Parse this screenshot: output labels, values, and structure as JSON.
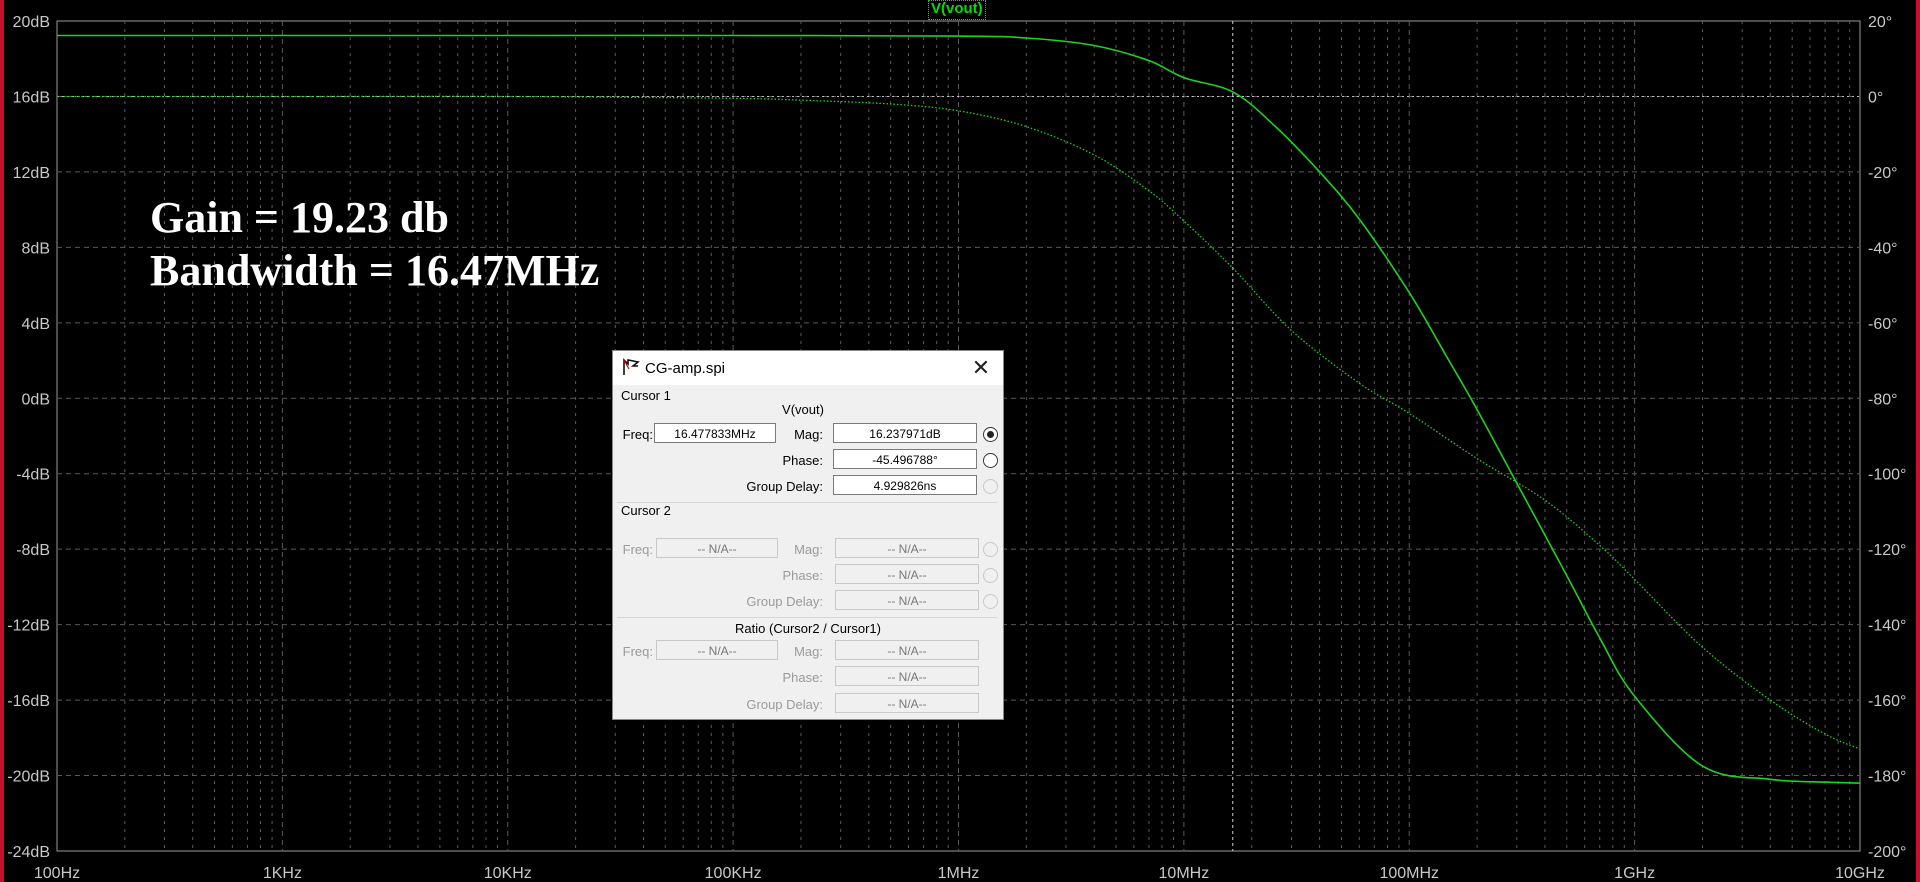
{
  "chart_data": {
    "type": "line",
    "title": "",
    "trace_label": "V(vout)",
    "x_scale": "log",
    "xlim": [
      100,
      10000000000
    ],
    "x_ticks": [
      "100Hz",
      "1KHz",
      "10KHz",
      "100KHz",
      "1MHz",
      "10MHz",
      "100MHz",
      "1GHz",
      "10GHz"
    ],
    "y_left_label": "",
    "ylim_left": [
      -24,
      20
    ],
    "y_left_ticks": [
      "20dB",
      "16dB",
      "12dB",
      "8dB",
      "4dB",
      "0dB",
      "-4dB",
      "-8dB",
      "-12dB",
      "-16dB",
      "-20dB",
      "-24dB"
    ],
    "ylim_right": [
      -200,
      20
    ],
    "y_right_ticks": [
      "20°",
      "0°",
      "-20°",
      "-40°",
      "-60°",
      "-80°",
      "-100°",
      "-120°",
      "-140°",
      "-160°",
      "-180°",
      "-200°"
    ],
    "grid": true,
    "cursor_x_hz": 16477833,
    "series": [
      {
        "axis": "left",
        "style": "solid",
        "color": "#1ed31e",
        "x": [
          100,
          1000,
          10000,
          100000,
          1000000,
          2000000,
          4000000,
          7000000,
          10000000,
          16477833,
          25000000,
          40000000,
          60000000,
          100000000,
          150000000,
          200000000,
          300000000,
          500000000,
          700000000,
          1000000000,
          2000000000,
          4000000000,
          7000000000,
          10000000000
        ],
        "y": [
          19.23,
          19.23,
          19.23,
          19.23,
          19.2,
          19.1,
          18.7,
          17.9,
          17.0,
          16.24,
          14.5,
          12.0,
          9.5,
          5.6,
          2.0,
          -0.6,
          -4.5,
          -9.4,
          -12.7,
          -15.8,
          -19.5,
          -20.2,
          -20.35,
          -20.4
        ]
      },
      {
        "axis": "right",
        "style": "dotted",
        "color": "#1ed31e",
        "x": [
          100,
          1000,
          10000,
          100000,
          200000,
          500000,
          1000000,
          2000000,
          4000000,
          7000000,
          10000000,
          16477833,
          30000000,
          60000000,
          100000000,
          200000000,
          400000000,
          700000000,
          1000000000,
          2000000000,
          4000000000,
          7000000000,
          10000000000
        ],
        "y": [
          0,
          0,
          0,
          -0.5,
          -1,
          -2,
          -3.8,
          -8,
          -15.5,
          -25,
          -33,
          -45.5,
          -62,
          -76,
          -84,
          -96,
          -107,
          -119,
          -128,
          -146,
          -160,
          -169,
          -173
        ]
      }
    ],
    "annotations": [
      "Gain = 19.23 db",
      "Bandwidth = 16.47MHz"
    ]
  },
  "dialog": {
    "title": "CG-amp.spi",
    "cursor1": {
      "header": "Cursor 1",
      "trace": "V(vout)",
      "freq_label": "Freq:",
      "freq": "16.477833MHz",
      "mag_label": "Mag:",
      "mag": "16.237971dB",
      "phase_label": "Phase:",
      "phase": "-45.496788°",
      "gd_label": "Group Delay:",
      "gd": "4.929826ns"
    },
    "cursor2": {
      "header": "Cursor 2",
      "freq_label": "Freq:",
      "freq": "-- N/A--",
      "mag_label": "Mag:",
      "mag": "-- N/A--",
      "phase_label": "Phase:",
      "phase": "-- N/A--",
      "gd_label": "Group Delay:",
      "gd": "-- N/A--"
    },
    "ratio": {
      "header": "Ratio (Cursor2 / Cursor1)",
      "freq_label": "Freq:",
      "freq": "-- N/A--",
      "mag_label": "Mag:",
      "mag": "-- N/A--",
      "phase_label": "Phase:",
      "phase": "-- N/A--",
      "gd_label": "Group Delay:",
      "gd": "-- N/A--"
    }
  }
}
